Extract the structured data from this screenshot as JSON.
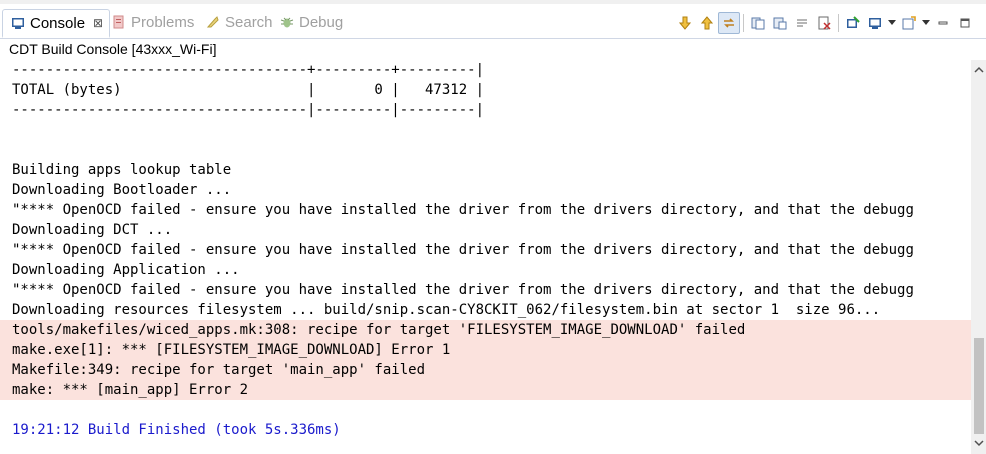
{
  "tabs": [
    {
      "label": "Console",
      "close": "⊠",
      "icon": "console-icon"
    },
    {
      "label": "Problems",
      "icon": "problems-icon"
    },
    {
      "label": "Search",
      "icon": "search-icon"
    },
    {
      "label": "Debug",
      "icon": "debug-icon"
    }
  ],
  "console_title": "CDT Build Console [43xxx_Wi-Fi]",
  "toolbar_icons": [
    "next-error-icon",
    "prev-error-icon",
    "link-icon",
    "copy-icon",
    "paste-icon",
    "word-wrap-icon",
    "clear-console-icon",
    "pin-console-icon",
    "display-selected-console-icon",
    "open-console-icon",
    "minimize-icon",
    "maximize-icon"
  ],
  "console_lines": [
    {
      "text": "-----------------------------------+---------+---------|",
      "type": "normal"
    },
    {
      "text": "TOTAL (bytes)                      |       0 |   47312 |",
      "type": "normal"
    },
    {
      "text": "-----------------------------------|---------|---------|",
      "type": "normal"
    },
    {
      "text": "",
      "type": "blank"
    },
    {
      "text": "",
      "type": "blank"
    },
    {
      "text": "Building apps lookup table",
      "type": "normal"
    },
    {
      "text": "Downloading Bootloader ...",
      "type": "normal"
    },
    {
      "text": "\"**** OpenOCD failed - ensure you have installed the driver from the drivers directory, and that the debugg",
      "type": "normal"
    },
    {
      "text": "Downloading DCT ...",
      "type": "normal"
    },
    {
      "text": "\"**** OpenOCD failed - ensure you have installed the driver from the drivers directory, and that the debugg",
      "type": "normal"
    },
    {
      "text": "Downloading Application ...",
      "type": "normal"
    },
    {
      "text": "\"**** OpenOCD failed - ensure you have installed the driver from the drivers directory, and that the debugg",
      "type": "normal"
    },
    {
      "text": "Downloading resources filesystem ... build/snip.scan-CY8CKIT_062/filesystem.bin at sector 1  size 96...",
      "type": "normal"
    },
    {
      "text": "tools/makefiles/wiced_apps.mk:308: recipe for target 'FILESYSTEM_IMAGE_DOWNLOAD' failed",
      "type": "err"
    },
    {
      "text": "make.exe[1]: *** [FILESYSTEM_IMAGE_DOWNLOAD] Error 1",
      "type": "err"
    },
    {
      "text": "Makefile:349: recipe for target 'main_app' failed",
      "type": "err"
    },
    {
      "text": "make: *** [main_app] Error 2",
      "type": "err"
    },
    {
      "text": "",
      "type": "blank"
    },
    {
      "text": "19:21:12 Build Finished (took 5s.336ms)",
      "type": "info"
    }
  ],
  "colors": {
    "error_bg": "#fbe2dd",
    "info_text": "#1a1acc",
    "tab_border": "#c9d3e3"
  }
}
